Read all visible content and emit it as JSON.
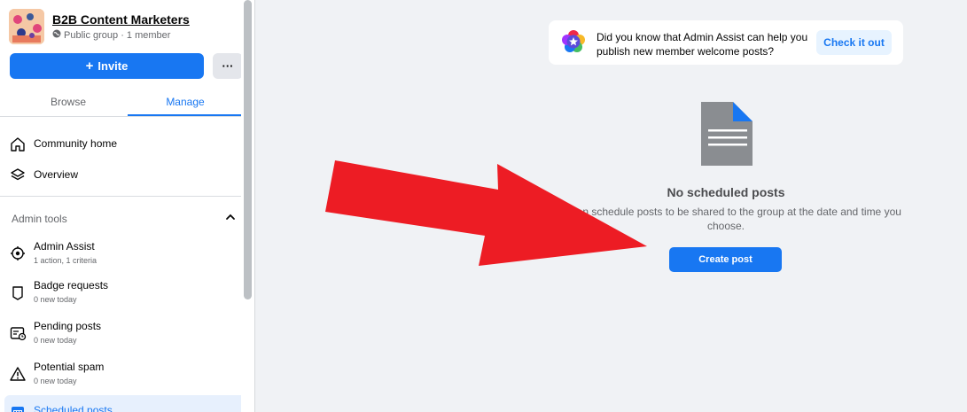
{
  "group": {
    "name": "B2B Content Marketers",
    "meta": "Public group · 1 member",
    "invite_label": "Invite",
    "more_label": "···"
  },
  "tabs": {
    "browse": "Browse",
    "manage": "Manage"
  },
  "nav": {
    "items": [
      {
        "label": "Community home",
        "icon": "home-icon"
      },
      {
        "label": "Overview",
        "icon": "overview-icon"
      }
    ]
  },
  "admin_tools": {
    "title": "Admin tools",
    "items": [
      {
        "label": "Admin Assist",
        "sub": "1 action, 1 criteria",
        "icon": "admin-assist-icon"
      },
      {
        "label": "Badge requests",
        "sub": "0 new today",
        "icon": "badge-icon"
      },
      {
        "label": "Pending posts",
        "sub": "0 new today",
        "icon": "pending-posts-icon"
      },
      {
        "label": "Potential spam",
        "sub": "0 new today",
        "icon": "warning-icon"
      },
      {
        "label": "Scheduled posts",
        "icon": "calendar-icon",
        "active": true
      }
    ]
  },
  "tip": {
    "text": "Did you know that Admin Assist can help you publish new member welcome posts?",
    "button_label": "Check it out"
  },
  "empty_state": {
    "title": "No scheduled posts",
    "description": "You can schedule posts to be shared to the group at the date and time you choose.",
    "button_label": "Create post"
  },
  "colors": {
    "accent": "#1877f2",
    "annotation_arrow": "#ed1c24"
  }
}
